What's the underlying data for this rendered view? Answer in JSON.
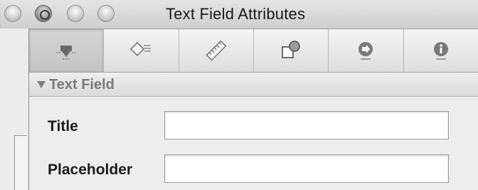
{
  "window": {
    "title": "Text Field Attributes"
  },
  "toolbar": {
    "tabs": [
      {
        "icon": "inspector-attributes-icon",
        "active": true
      },
      {
        "icon": "inspector-effects-icon",
        "active": false
      },
      {
        "icon": "inspector-size-ruler-icon",
        "active": false
      },
      {
        "icon": "inspector-bindings-icon",
        "active": false
      },
      {
        "icon": "inspector-connections-arrow-icon",
        "active": false
      },
      {
        "icon": "inspector-identity-info-icon",
        "active": false
      }
    ]
  },
  "section": {
    "title": "Text Field"
  },
  "form": {
    "title_label": "Title",
    "title_value": "",
    "placeholder_label": "Placeholder",
    "placeholder_value": ""
  }
}
